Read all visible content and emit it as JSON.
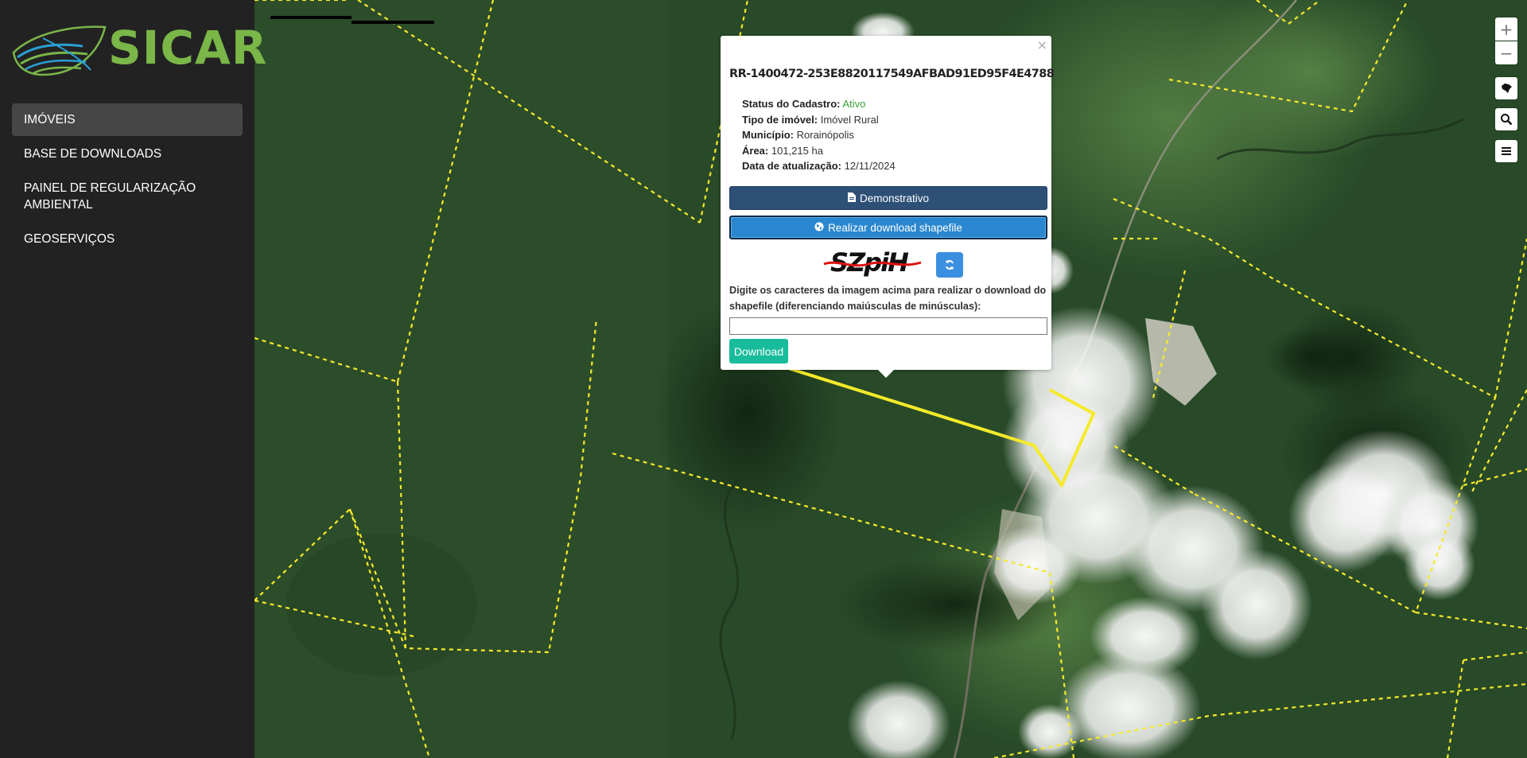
{
  "app": {
    "logo_text": "SICAR"
  },
  "sidebar": {
    "items": [
      {
        "label": "IMÓVEIS",
        "active": true
      },
      {
        "label": "BASE DE DOWNLOADS",
        "active": false
      },
      {
        "label": "PAINEL DE REGULARIZAÇÃO AMBIENTAL",
        "active": false
      },
      {
        "label": "GEOSERVIÇOS",
        "active": false
      }
    ]
  },
  "map_controls": {
    "zoom_in": "+",
    "zoom_out": "−",
    "icons": [
      "brazil-map-icon",
      "search-icon",
      "layers-menu-icon"
    ]
  },
  "popup": {
    "close": "×",
    "title": "RR-1400472-253E8820117549AFBAD91ED95F4E4788",
    "fields": [
      {
        "label": "Status do Cadastro:",
        "value": "Ativo"
      },
      {
        "label": "Tipo de imóvel:",
        "value": "Imóvel Rural"
      },
      {
        "label": "Município:",
        "value": "Rorainópolis"
      },
      {
        "label": "Área:",
        "value": "101,215 ha"
      },
      {
        "label": "Data de atualização:",
        "value": "12/11/2024"
      }
    ],
    "status_color": "#3a9f3a",
    "buttons": {
      "demonstrativo": "Demonstrativo",
      "shapefile": "Realizar download shapefile",
      "download": "Download"
    },
    "captcha_text": "SZpiH",
    "captcha_instructions": "Digite os caracteres da imagem acima para realizar o download do shapefile (diferenciando maiúsculas de minúsculas):",
    "captcha_input_value": ""
  },
  "colors": {
    "brand_green": "#7ab648",
    "sidebar_bg": "#222222",
    "demo_btn": "#2e5077",
    "shape_btn": "#2a87cf",
    "download_btn": "#18bc9c",
    "property_boundary": "#f5ea2a"
  }
}
